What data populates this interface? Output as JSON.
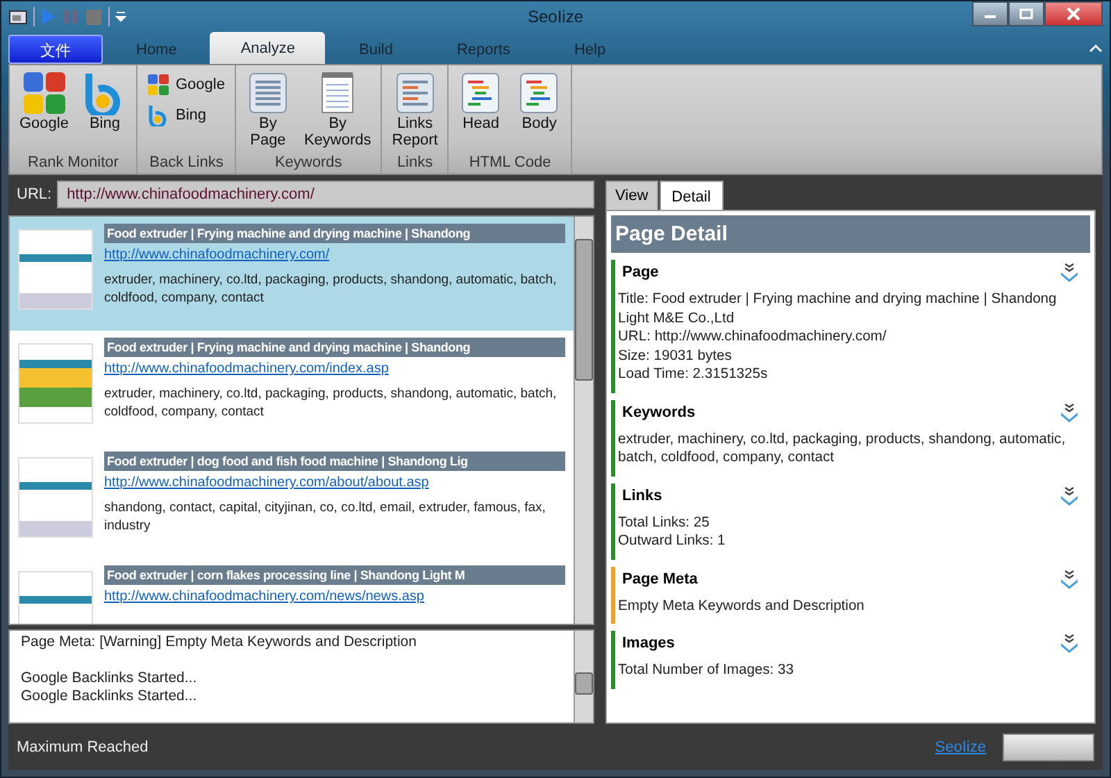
{
  "window": {
    "title": "SeoIize"
  },
  "ribbon_tabs": [
    {
      "label": "文件",
      "kind": "file",
      "selected": false
    },
    {
      "label": "Home",
      "kind": "tab",
      "selected": false
    },
    {
      "label": "Analyze",
      "kind": "tab",
      "selected": true
    },
    {
      "label": "Build",
      "kind": "tab",
      "selected": false
    },
    {
      "label": "Reports",
      "kind": "tab",
      "selected": false
    },
    {
      "label": "Help",
      "kind": "tab",
      "selected": false
    }
  ],
  "ribbon_groups": [
    {
      "label": "Rank Monitor",
      "kind": "large",
      "items": [
        "Google",
        "Bing"
      ]
    },
    {
      "label": "Back Links",
      "kind": "small",
      "items": [
        "Google",
        "Bing"
      ]
    },
    {
      "label": "Keywords",
      "kind": "large",
      "items": [
        "By\nPage",
        "By\nKeywords"
      ]
    },
    {
      "label": "Links",
      "kind": "large",
      "items": [
        "Links\nReport"
      ]
    },
    {
      "label": "HTML Code",
      "kind": "large",
      "items": [
        "Head",
        "Body"
      ]
    }
  ],
  "url_bar": {
    "label": "URL:",
    "value": "http://www.chinafoodmachinery.com/"
  },
  "results": [
    {
      "title": "Food extruder  | Frying machine and drying machine  | Shandong",
      "url": "http://www.chinafoodmachinery.com/",
      "keywords": "extruder, machinery, co.ltd, packaging, products, shandong, automatic, batch, coldfood, company, contact",
      "selected": true
    },
    {
      "title": "Food extruder  | Frying machine and drying machine  | Shandong",
      "url": "http://www.chinafoodmachinery.com/index.asp",
      "keywords": "extruder, machinery, co.ltd, packaging, products, shandong, automatic, batch, coldfood, company, contact",
      "selected": false
    },
    {
      "title": "Food extruder |  dog food and fish food machine |  Shandong Lig",
      "url": "http://www.chinafoodmachinery.com/about/about.asp",
      "keywords": "shandong, contact, capital, cityjinan, co, co.ltd, email, extruder, famous, fax, industry",
      "selected": false
    },
    {
      "title": "Food extruder |  corn flakes processing line |  Shandong Light M",
      "url": "http://www.chinafoodmachinery.com/news/news.asp",
      "selected": false
    }
  ],
  "log": [
    [
      "Page Meta: [Warning] Empty Meta Keywords and Description"
    ],
    [
      "Google Backlinks Started...",
      "Google Backlinks Started..."
    ]
  ],
  "detail_tabs": [
    {
      "label": "View",
      "selected": false
    },
    {
      "label": "Detail",
      "selected": true
    }
  ],
  "detail": {
    "heading": "Page Detail",
    "sections": [
      {
        "title": "Page",
        "color": "#2e8b2e",
        "lines": [
          "Title: Food extruder  | Frying machine and drying machine  | Shandong Light M&E Co.,Ltd",
          "URL: http://www.chinafoodmachinery.com/",
          "Size: 19031 bytes",
          "Load Time: 2.3151325s"
        ]
      },
      {
        "title": "Keywords",
        "color": "#2e8b2e",
        "lines": [
          "extruder, machinery, co.ltd, packaging, products, shandong, automatic, batch, coldfood, company, contact"
        ]
      },
      {
        "title": "Links",
        "color": "#2e8b2e",
        "lines": [
          "Total Links: 25",
          "Outward Links: 1"
        ]
      },
      {
        "title": "Page Meta",
        "color": "#f0a030",
        "lines": [
          "Empty Meta Keywords and Description"
        ]
      },
      {
        "title": "Images",
        "color": "#2e8b2e",
        "lines": [
          "Total Number of Images: 33"
        ]
      }
    ]
  },
  "status_bar": {
    "message": "Maximum Reached",
    "link": "SeoIize"
  }
}
